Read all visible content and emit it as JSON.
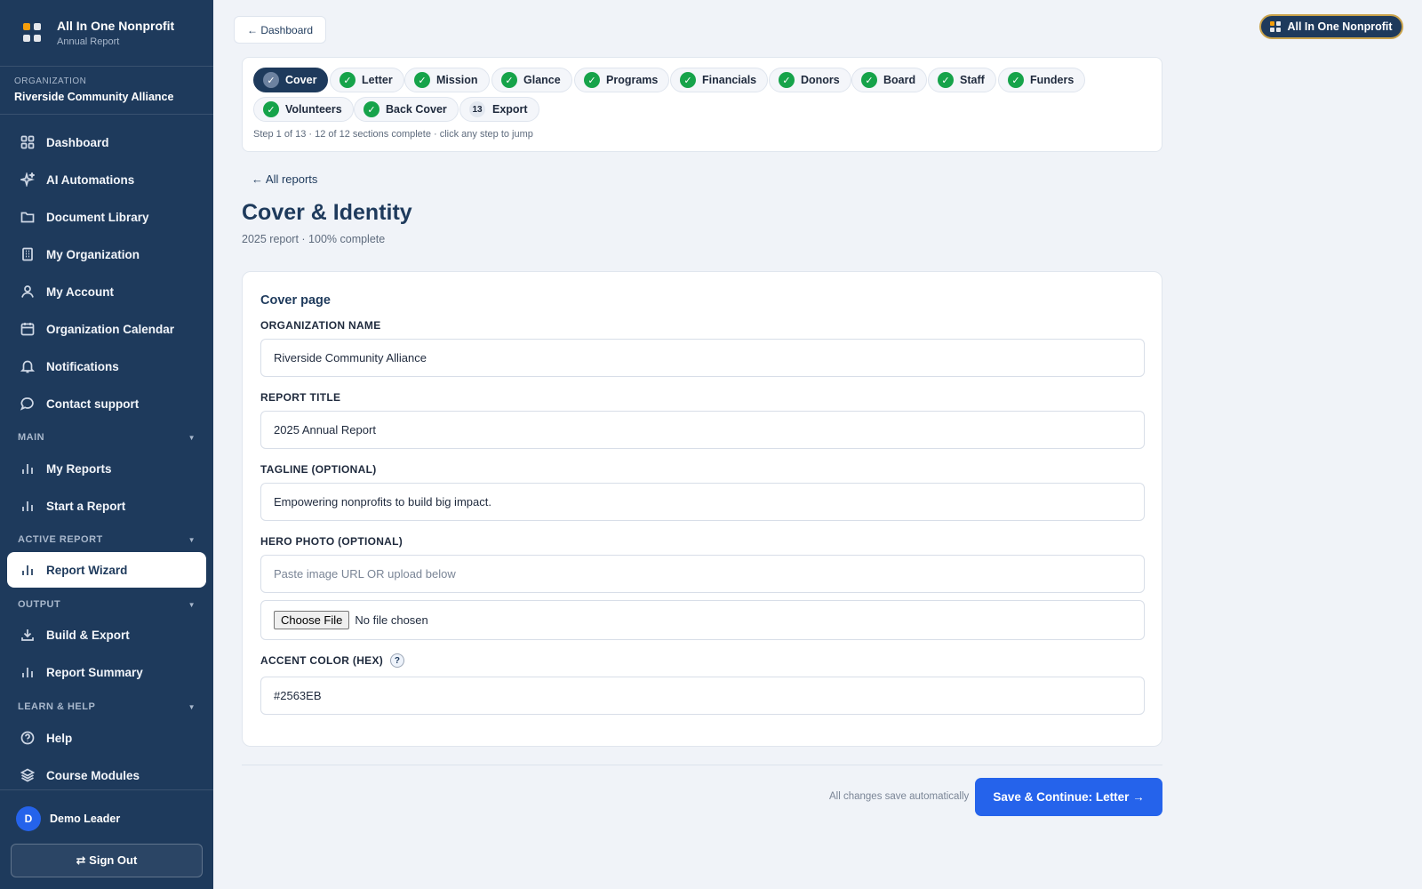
{
  "app": {
    "name": "All In One Nonprofit",
    "subtitle": "Annual Report",
    "logo_colors": [
      "#f59e0b",
      "#e5e7eb",
      "#e5e7eb",
      "#e5e7eb"
    ]
  },
  "organization": {
    "label": "Organization",
    "name": "Riverside Community Alliance"
  },
  "sidebar": {
    "top_items": [
      {
        "label": "Dashboard",
        "icon": "dashboard-icon"
      },
      {
        "label": "AI Automations",
        "icon": "sparkles-icon"
      },
      {
        "label": "Document Library",
        "icon": "folder-icon"
      },
      {
        "label": "My Organization",
        "icon": "building-icon"
      },
      {
        "label": "My Account",
        "icon": "user-icon"
      },
      {
        "label": "Organization Calendar",
        "icon": "calendar-icon"
      },
      {
        "label": "Notifications",
        "icon": "bell-icon"
      },
      {
        "label": "Contact support",
        "icon": "chat-icon"
      }
    ],
    "sections": [
      {
        "title": "MAIN",
        "items": [
          {
            "label": "My Reports",
            "icon": "bar-chart-icon"
          },
          {
            "label": "Start a Report",
            "icon": "bar-chart-icon"
          }
        ]
      },
      {
        "title": "ACTIVE REPORT",
        "items": [
          {
            "label": "Report Wizard",
            "icon": "bar-chart-icon",
            "active": true
          }
        ]
      },
      {
        "title": "OUTPUT",
        "items": [
          {
            "label": "Build & Export",
            "icon": "download-icon"
          },
          {
            "label": "Report Summary",
            "icon": "bar-chart-icon"
          }
        ]
      },
      {
        "title": "LEARN & HELP",
        "items": [
          {
            "label": "Help",
            "icon": "help-circle-icon"
          },
          {
            "label": "Course Modules",
            "icon": "layers-icon"
          }
        ]
      }
    ],
    "user": {
      "initial": "D",
      "name": "Demo Leader"
    },
    "sign_out": "⇄ Sign Out"
  },
  "topbar": {
    "dashboard_button": "← Dashboard",
    "brand_pill": "All In One Nonprofit"
  },
  "steps": [
    {
      "label": "Cover",
      "state": "current"
    },
    {
      "label": "Letter",
      "state": "done"
    },
    {
      "label": "Mission",
      "state": "done"
    },
    {
      "label": "Glance",
      "state": "done"
    },
    {
      "label": "Programs",
      "state": "done"
    },
    {
      "label": "Financials",
      "state": "done"
    },
    {
      "label": "Donors",
      "state": "done"
    },
    {
      "label": "Board",
      "state": "done"
    },
    {
      "label": "Staff",
      "state": "done"
    },
    {
      "label": "Funders",
      "state": "done"
    },
    {
      "label": "Volunteers",
      "state": "done"
    },
    {
      "label": "Back Cover",
      "state": "done"
    },
    {
      "label": "Export",
      "state": "pending",
      "number": "13"
    }
  ],
  "steps_note": "Step 1 of 13 · 12 of 12 sections complete · click any step to jump",
  "back_link": "← All reports",
  "page": {
    "title": "Cover & Identity",
    "subtitle": "2025 report · 100% complete"
  },
  "form": {
    "card_title": "Cover page",
    "fields": {
      "org_name": {
        "label": "ORGANIZATION NAME",
        "value": "Riverside Community Alliance"
      },
      "report_title": {
        "label": "REPORT TITLE",
        "value": "2025 Annual Report"
      },
      "tagline": {
        "label": "TAGLINE (OPTIONAL)",
        "value": "Empowering nonprofits to build big impact."
      },
      "hero_photo": {
        "label": "HERO PHOTO (OPTIONAL)",
        "value": "",
        "placeholder": "Paste image URL OR upload below"
      },
      "file": {
        "button": "Choose File",
        "status": "No file chosen"
      },
      "accent": {
        "label": "ACCENT COLOR (HEX)",
        "value": "#2563EB",
        "help": "?"
      }
    }
  },
  "footer": {
    "autosave": "All changes save automatically",
    "save_button": "Save & Continue: Letter →"
  },
  "colors": {
    "sidebar": "#1e3a5c",
    "accent": "#2563eb",
    "done": "#16a34a",
    "brand_border": "#c9a24a"
  }
}
